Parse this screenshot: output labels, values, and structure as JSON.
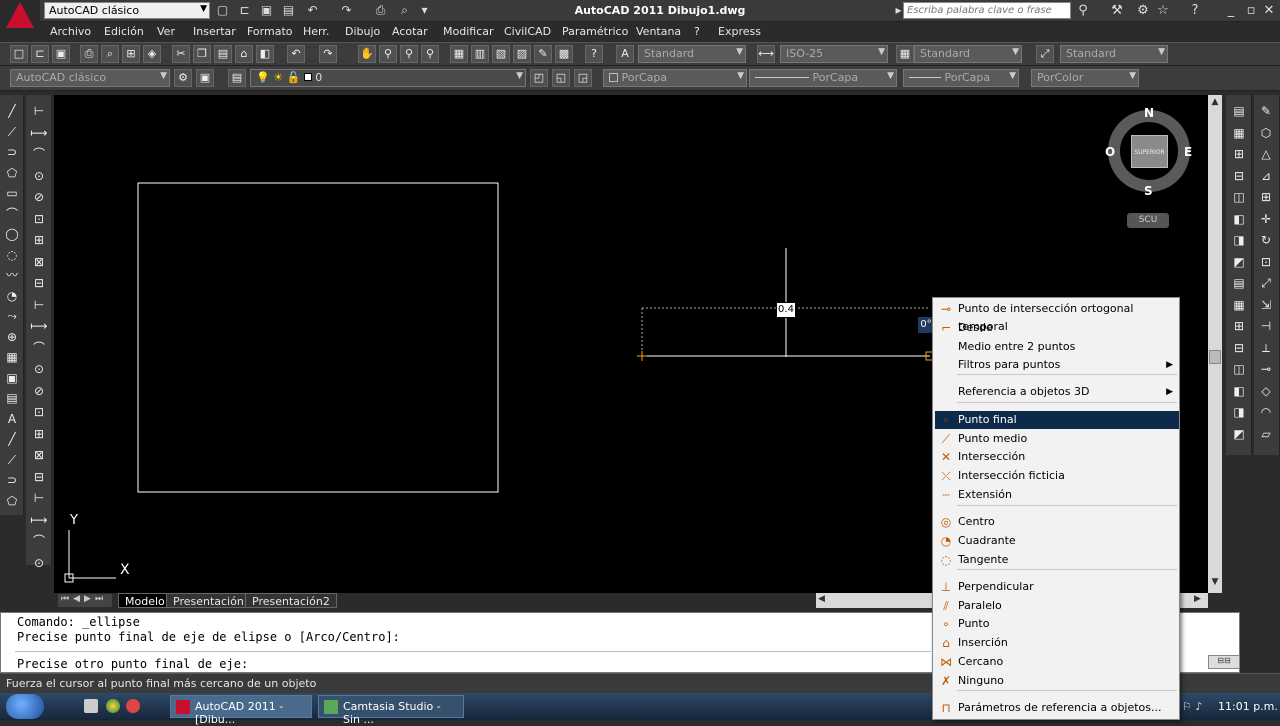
{
  "title_bar": {
    "workspace": "AutoCAD clásico",
    "window_title": "AutoCAD 2011    Dibujo1.dwg",
    "search_placeholder": "Escriba palabra clave o frase"
  },
  "menu": [
    "Archivo",
    "Edición",
    "Ver",
    "Insertar",
    "Formato",
    "Herr.",
    "Dibujo",
    "Acotar",
    "Modificar",
    "CivilCAD",
    "Paramétrico",
    "Ventana",
    "?",
    "Express"
  ],
  "toolbar1": {
    "text_style": "Standard",
    "dim_style": "ISO-25",
    "table_style": "Standard",
    "mleader_style": "Standard"
  },
  "toolbar2": {
    "workspace": "AutoCAD clásico",
    "layer": "0",
    "color": "PorCapa",
    "linetype": "PorCapa",
    "lineweight": "PorCapa",
    "plotstyle": "PorColor"
  },
  "viewcube": {
    "north": "N",
    "south": "S",
    "east": "E",
    "west": "O",
    "face": "SUPERIOR",
    "ucs": "SCU"
  },
  "canvas": {
    "ucs_x": "X",
    "ucs_y": "Y",
    "dyn_input_value": "0.4",
    "dyn_angle": "0°"
  },
  "tabs": [
    "Modelo",
    "Presentación1",
    "Presentación2"
  ],
  "command_lines": [
    "Comando: _ellipse",
    "Precise punto final de eje de elipse o [Arco/Centro]:",
    "Precise otro punto final de eje:"
  ],
  "status_text": "Fuerza el cursor al punto final más cercano de un objeto",
  "taskbar": {
    "tasks": [
      "AutoCAD 2011 - [Dibu...",
      "Camtasia Studio - Sin ..."
    ],
    "clock": "11:01 p.m."
  },
  "context_menu": {
    "items": [
      {
        "label": "Punto de intersección ortogonal temporal"
      },
      {
        "label": "Desde"
      },
      {
        "label": "Medio entre 2 puntos"
      },
      {
        "label": "Filtros para puntos"
      },
      {
        "label": "Referencia a objetos 3D"
      },
      {
        "label": "Punto final"
      },
      {
        "label": "Punto medio"
      },
      {
        "label": "Intersección"
      },
      {
        "label": "Intersección ficticia"
      },
      {
        "label": "Extensión"
      },
      {
        "label": "Centro"
      },
      {
        "label": "Cuadrante"
      },
      {
        "label": "Tangente"
      },
      {
        "label": "Perpendicular"
      },
      {
        "label": "Paralelo"
      },
      {
        "label": "Punto"
      },
      {
        "label": "Inserción"
      },
      {
        "label": "Cercano"
      },
      {
        "label": "Ninguno"
      },
      {
        "label": "Parámetros de referencia a objetos..."
      }
    ],
    "highlighted": "Punto final"
  }
}
